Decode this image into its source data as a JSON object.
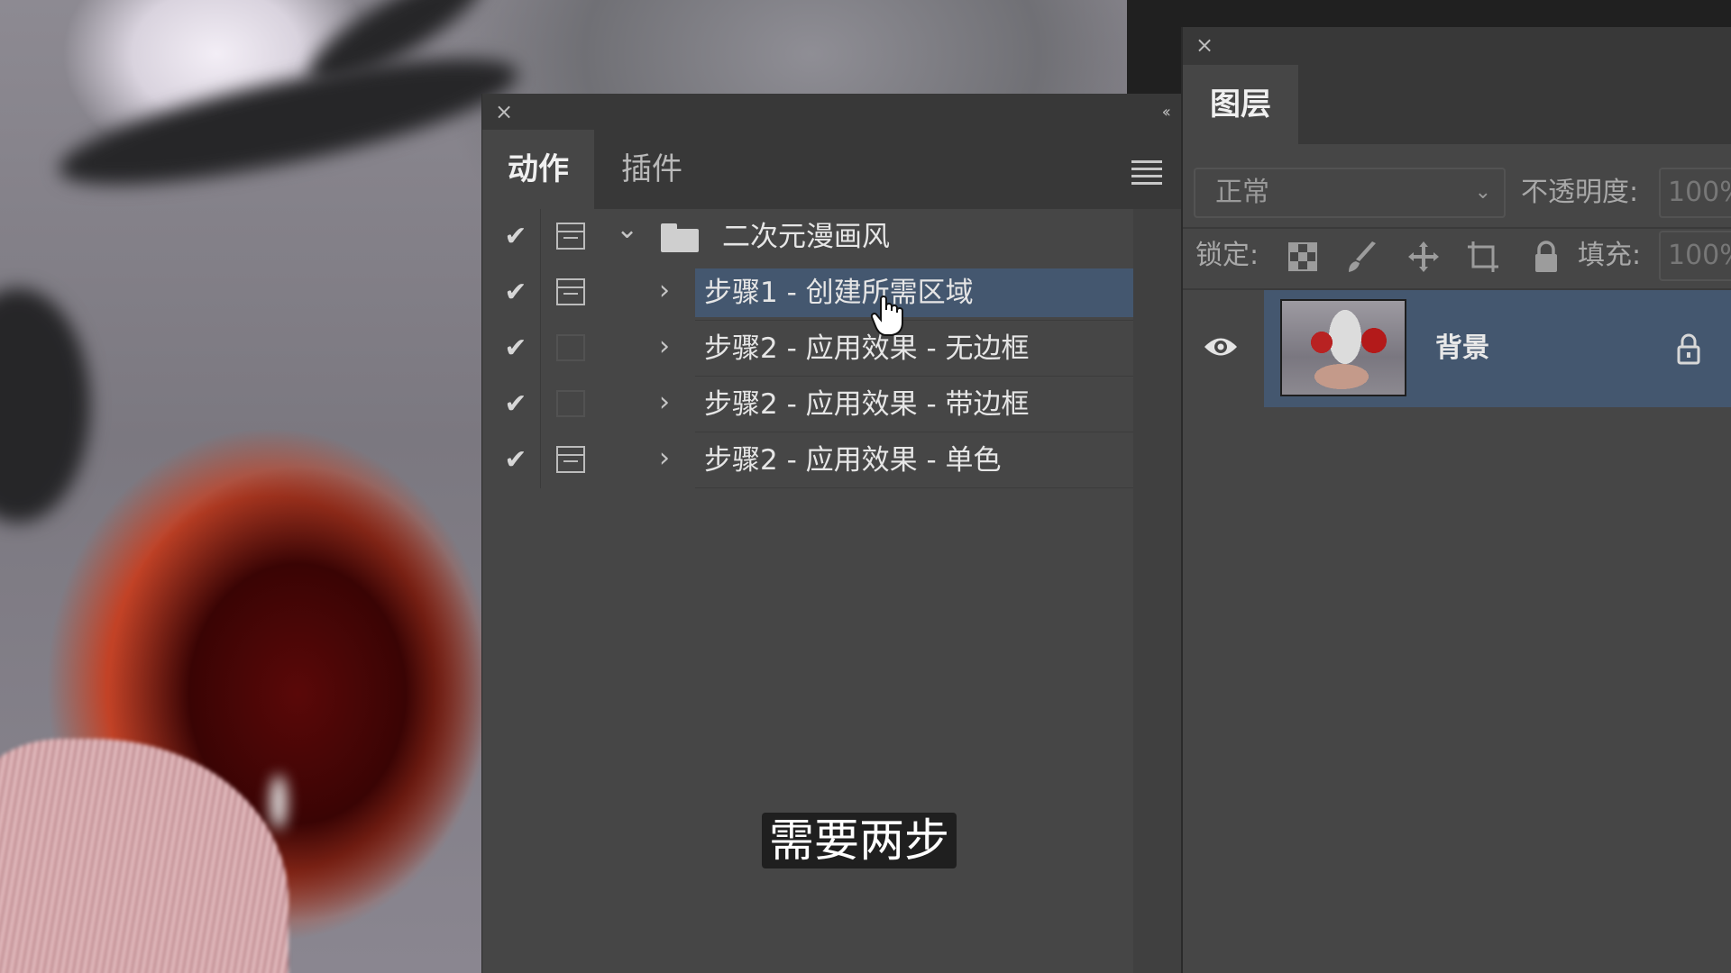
{
  "actions_panel": {
    "close_glyph": "×",
    "collapse_glyph": "‹‹",
    "tabs": [
      {
        "label": "动作",
        "active": true
      },
      {
        "label": "插件",
        "active": false
      }
    ],
    "rows": [
      {
        "label": "二次元漫画风",
        "checked": true,
        "dialog": true,
        "type": "set",
        "expanded": true,
        "selected": false
      },
      {
        "label": "步骤1 - 创建所需区域",
        "checked": true,
        "dialog": true,
        "type": "action",
        "expanded": false,
        "selected": true
      },
      {
        "label": "步骤2 - 应用效果 - 无边框",
        "checked": true,
        "dialog": false,
        "type": "action",
        "expanded": false,
        "selected": false
      },
      {
        "label": "步骤2 - 应用效果 - 带边框",
        "checked": true,
        "dialog": false,
        "type": "action",
        "expanded": false,
        "selected": false
      },
      {
        "label": "步骤2 - 应用效果 - 单色",
        "checked": true,
        "dialog": true,
        "type": "action",
        "expanded": false,
        "selected": false
      }
    ],
    "check_glyph": "✔",
    "chevron_right": "›",
    "chevron_down": "⌄"
  },
  "layers_panel": {
    "close_glyph": "×",
    "tab_label": "图层",
    "blend_mode": "正常",
    "opacity_label": "不透明度:",
    "opacity_value": "100%",
    "lock_label": "锁定:",
    "fill_label": "填充:",
    "fill_value": "100%",
    "layers": [
      {
        "name": "背景",
        "visible": true,
        "locked": true,
        "selected": true
      }
    ]
  },
  "subtitle": "需要两步",
  "colors": {
    "panel_bg": "#464646",
    "header_bg": "#383838",
    "selection": "#44576f"
  }
}
